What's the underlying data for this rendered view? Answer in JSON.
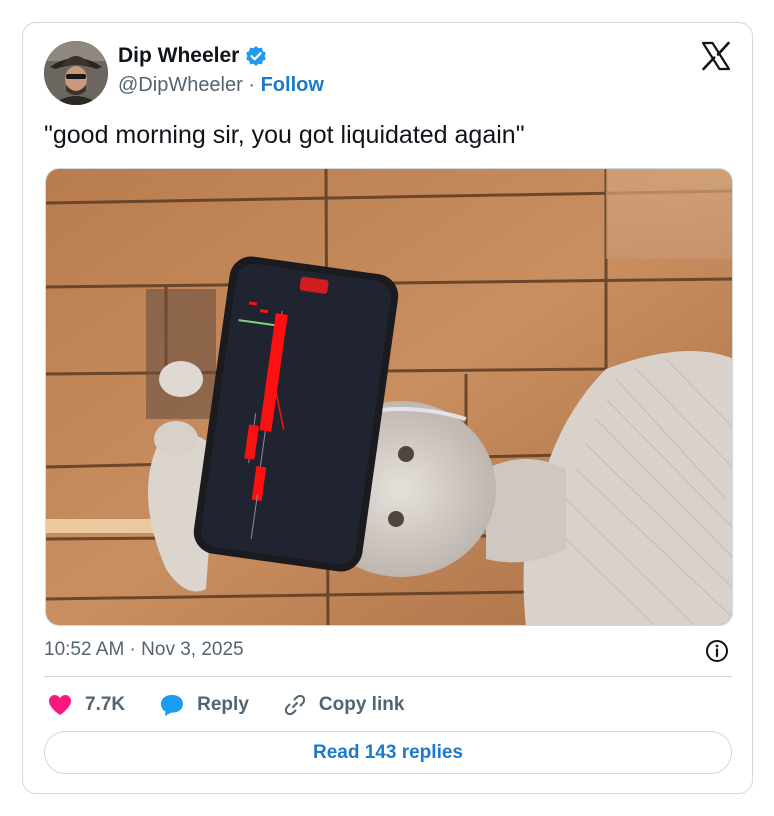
{
  "author": {
    "display_name": "Dip Wheeler",
    "handle": "@DipWheeler",
    "separator": " · ",
    "follow_label": "Follow",
    "verified": true
  },
  "tweet": {
    "text": "\"good morning sir, you got liquidated again\"",
    "timestamp": "10:52 AM · Nov 3, 2025"
  },
  "actions": {
    "like_count": "7.7K",
    "reply_label": "Reply",
    "copy_link_label": "Copy link"
  },
  "read_replies_label": "Read 143 replies",
  "colors": {
    "accent": "#1d79c9",
    "like": "#f91880",
    "reply_icon": "#1d9bf0",
    "muted": "#536471",
    "border": "#cfd9de"
  },
  "icons": [
    "avatar",
    "verified-badge-icon",
    "x-logo-icon",
    "info-icon",
    "heart-icon",
    "reply-bubble-icon",
    "link-icon"
  ]
}
